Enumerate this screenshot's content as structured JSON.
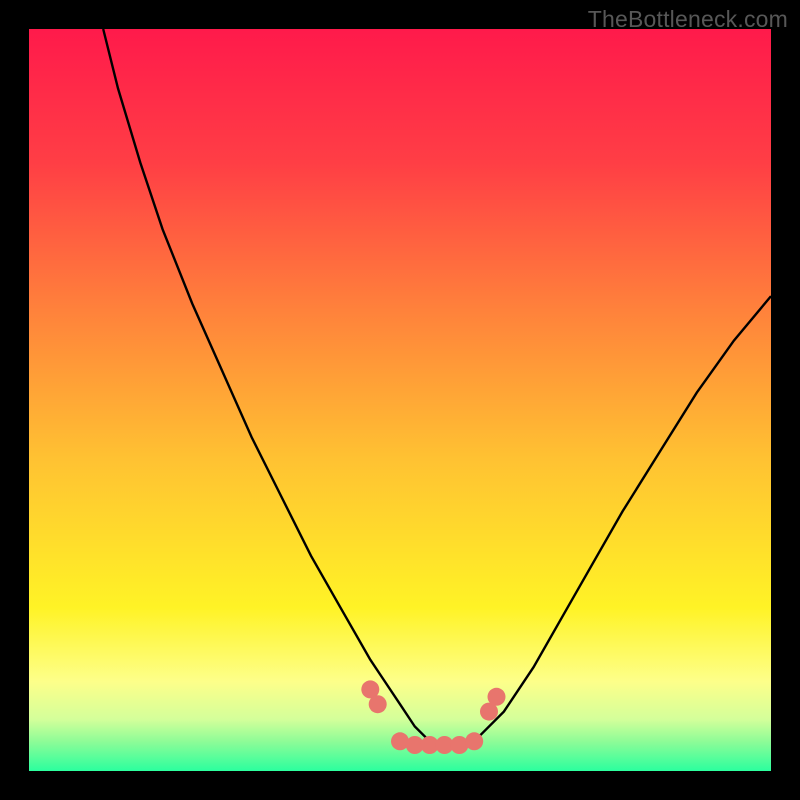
{
  "watermark": "TheBottleneck.com",
  "gradient": {
    "stops": [
      {
        "pct": 0,
        "color": "#ff1a4b"
      },
      {
        "pct": 18,
        "color": "#ff3e45"
      },
      {
        "pct": 38,
        "color": "#ff823b"
      },
      {
        "pct": 58,
        "color": "#ffc232"
      },
      {
        "pct": 78,
        "color": "#fff326"
      },
      {
        "pct": 88,
        "color": "#fdff8a"
      },
      {
        "pct": 93,
        "color": "#d4ff9a"
      },
      {
        "pct": 96,
        "color": "#8efc97"
      },
      {
        "pct": 100,
        "color": "#2bff9e"
      }
    ]
  },
  "marker": {
    "color": "#e8756d",
    "radius": 9
  },
  "curve_stroke": "#000000",
  "chart_data": {
    "type": "line",
    "title": "",
    "xlabel": "",
    "ylabel": "",
    "xlim": [
      0,
      100
    ],
    "ylim": [
      0,
      100
    ],
    "series": [
      {
        "name": "bottleneck-curve",
        "x": [
          10,
          12,
          15,
          18,
          22,
          26,
          30,
          34,
          38,
          42,
          46,
          50,
          52,
          54,
          56,
          58,
          60,
          64,
          68,
          72,
          76,
          80,
          85,
          90,
          95,
          100
        ],
        "y": [
          100,
          92,
          82,
          73,
          63,
          54,
          45,
          37,
          29,
          22,
          15,
          9,
          6,
          4,
          3,
          3,
          4,
          8,
          14,
          21,
          28,
          35,
          43,
          51,
          58,
          64
        ]
      }
    ],
    "markers": {
      "name": "highlight-points",
      "x": [
        46,
        47,
        50,
        52,
        54,
        56,
        58,
        60,
        62,
        63
      ],
      "y": [
        11,
        9,
        4,
        3.5,
        3.5,
        3.5,
        3.5,
        4,
        8,
        10
      ]
    }
  }
}
